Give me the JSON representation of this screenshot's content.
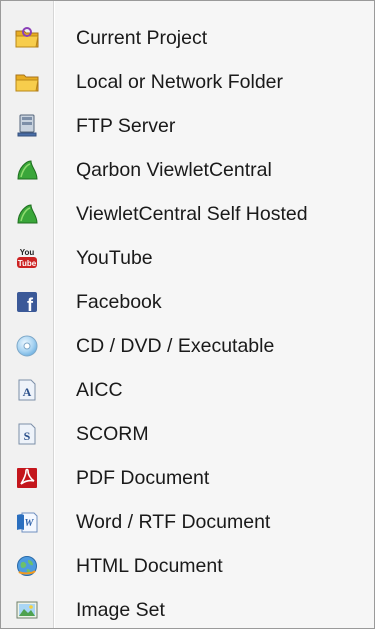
{
  "menu": {
    "items": [
      {
        "label": "Current Project",
        "icon": "folder-project-icon"
      },
      {
        "label": "Local or Network Folder",
        "icon": "folder-icon"
      },
      {
        "label": "FTP Server",
        "icon": "ftp-server-icon"
      },
      {
        "label": "Qarbon ViewletCentral",
        "icon": "viewletcentral-icon"
      },
      {
        "label": "ViewletCentral Self Hosted",
        "icon": "viewletcentral-selfhosted-icon"
      },
      {
        "label": "YouTube",
        "icon": "youtube-icon"
      },
      {
        "label": "Facebook",
        "icon": "facebook-icon"
      },
      {
        "label": "CD / DVD / Executable",
        "icon": "cd-dvd-icon"
      },
      {
        "label": "AICC",
        "icon": "aicc-icon"
      },
      {
        "label": "SCORM",
        "icon": "scorm-icon"
      },
      {
        "label": "PDF Document",
        "icon": "pdf-icon"
      },
      {
        "label": "Word / RTF Document",
        "icon": "word-icon"
      },
      {
        "label": "HTML Document",
        "icon": "html-icon"
      },
      {
        "label": "Image Set",
        "icon": "image-set-icon"
      }
    ],
    "youtube_icon_text": "You Tube",
    "facebook_icon_text": "f",
    "aicc_icon_text": "A",
    "scorm_icon_text": "S",
    "word_icon_text": "W"
  },
  "colors": {
    "folder": "#f2c23a",
    "green_leaf": "#3aa63a",
    "youtube_red": "#cc2222",
    "facebook_blue": "#3b5998",
    "pdf_red": "#c4161c",
    "link_blue": "#2b6fbf"
  }
}
